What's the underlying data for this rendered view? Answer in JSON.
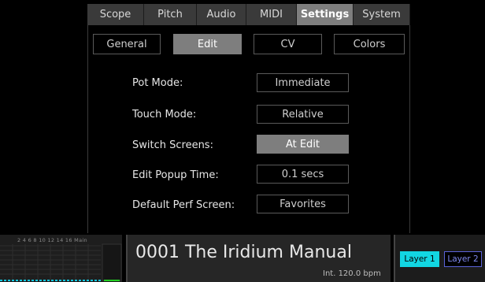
{
  "top_tabs": [
    {
      "label": "Scope"
    },
    {
      "label": "Pitch"
    },
    {
      "label": "Audio"
    },
    {
      "label": "MIDI"
    },
    {
      "label": "Settings",
      "active": true
    },
    {
      "label": "System"
    }
  ],
  "sub_tabs": [
    {
      "label": "General"
    },
    {
      "label": "Edit",
      "active": true
    },
    {
      "label": "CV"
    },
    {
      "label": "Colors"
    }
  ],
  "settings": [
    {
      "label": "Pot Mode:",
      "value": "Immediate"
    },
    {
      "label": "Touch Mode:",
      "value": "Relative"
    },
    {
      "label": "Switch Screens:",
      "value": "At Edit",
      "active": true
    },
    {
      "label": "Edit Popup Time:",
      "value": "0.1 secs"
    },
    {
      "label": "Default Perf Screen:",
      "value": "Favorites"
    }
  ],
  "status": {
    "meter_labels": "2 4 6 8 10 12 14 16 Main",
    "patch_name": "0001 The Iridium Manual",
    "tempo": "Int. 120.0 bpm",
    "layers": [
      {
        "label": "Layer 1",
        "active": true
      },
      {
        "label": "Layer 2"
      }
    ]
  },
  "colors": {
    "active_tab": "#7e7e7e",
    "layer1_bg": "#12d6e2",
    "layer2_border": "#5b63d8"
  }
}
